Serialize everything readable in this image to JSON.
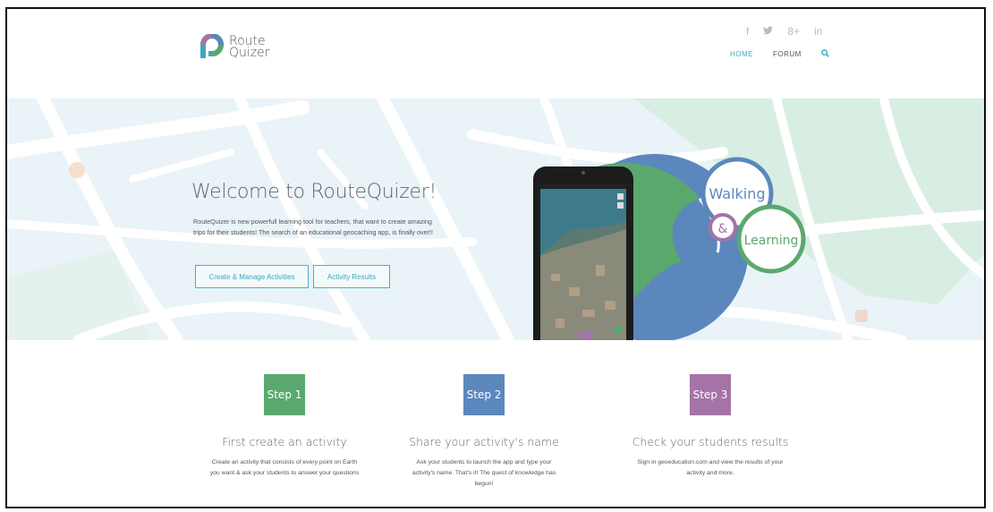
{
  "brand": {
    "line1": "Route",
    "line2": "Quizer",
    "colors": {
      "teal": "#3aa8c1",
      "blue": "#5b87bd",
      "purple": "#a673a6",
      "green": "#5aa86e"
    }
  },
  "social": [
    "f",
    "🐦",
    "8+",
    "in"
  ],
  "nav": {
    "home": "HOME",
    "forum": "FORUM",
    "search_icon": "search-icon"
  },
  "hero": {
    "title": "Welcome to RouteQuizer!",
    "description": "RouteQuizer is new powerfull learning tool for teachers, that want to create amazing trips for their students! The search of an educational geocaching app, is finally over!!",
    "buttons": {
      "create": "Create & Manage Activities",
      "results": "Activity Results"
    },
    "graphic": {
      "walking": "Walking",
      "amp": "&",
      "learning": "Learning"
    }
  },
  "steps": [
    {
      "badge": "Step 1",
      "color": "#5aa86e",
      "title": "First create an activity",
      "text": "Create an activity that consists of every point on Earth you want & ask your students to answer your questions"
    },
    {
      "badge": "Step 2",
      "color": "#5b87bd",
      "title": "Share your activity's name",
      "text": "Ask your students to launch the app and type your activity's name. That's it! The quest of knowledge has begun!"
    },
    {
      "badge": "Step 3",
      "color": "#a673a6",
      "title": "Check your students results",
      "text": "Sign in geoeducation.com and view the results of your activity and more."
    }
  ]
}
